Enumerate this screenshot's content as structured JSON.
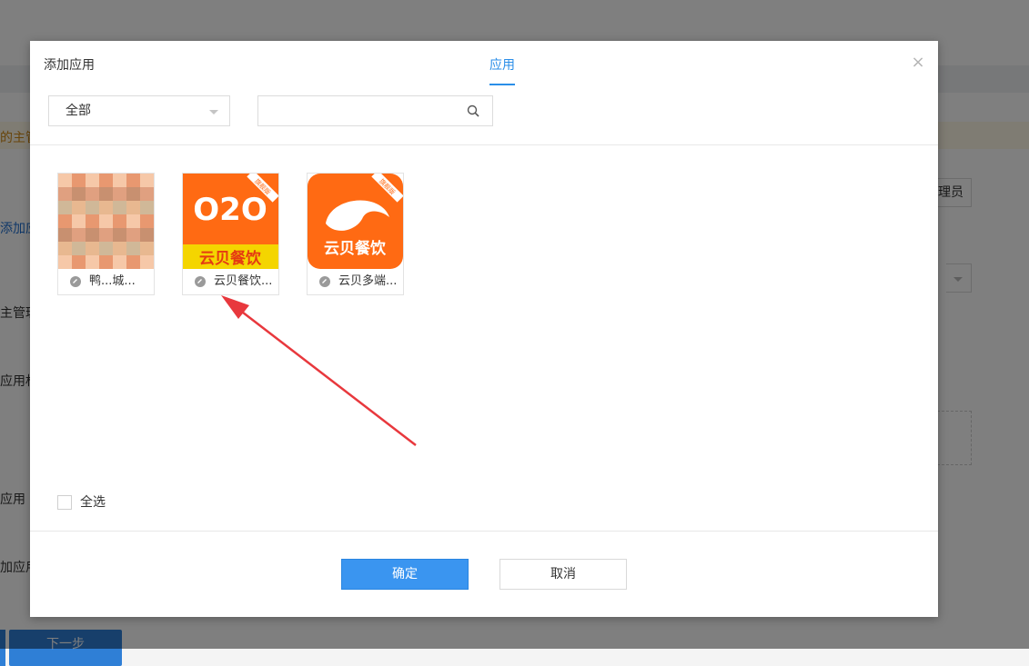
{
  "background": {
    "fragments": [
      {
        "id": "notice",
        "text": "的主管"
      },
      {
        "id": "add-link",
        "text": "添加应"
      },
      {
        "id": "admin-label",
        "text": "主管理"
      },
      {
        "id": "perm-label",
        "text": "应用权"
      },
      {
        "id": "app-label",
        "text": "应用"
      },
      {
        "id": "add-app-label",
        "text": "加应用"
      }
    ],
    "side_button": "理员",
    "next_button": "下一步"
  },
  "modal": {
    "title": "添加应用",
    "tab": "应用",
    "close_symbol": "×",
    "filter": {
      "selected": "全部"
    },
    "search": {
      "placeholder": "",
      "value": ""
    },
    "apps": [
      {
        "name": "鸭...城...",
        "thumb": "pixelated"
      },
      {
        "name": "云贝餐饮...",
        "thumb": "o2o",
        "thumb_text": "O2O",
        "thumb_sub": "云贝餐饮",
        "ribbon": "旗舰版",
        "thumb_color": "#ff6a13",
        "sub_color": "#f4d500"
      },
      {
        "name": "云贝多端...",
        "thumb": "multi",
        "thumb_sub": "云贝餐饮",
        "ribbon": "旗舰版",
        "thumb_color": "#ff6a13"
      }
    ],
    "select_all_label": "全选",
    "ok_label": "确定",
    "cancel_label": "取消"
  },
  "colors": {
    "accent": "#2a8ee8",
    "primary_button": "#3a95f0",
    "annotation_arrow": "#e8383d"
  }
}
